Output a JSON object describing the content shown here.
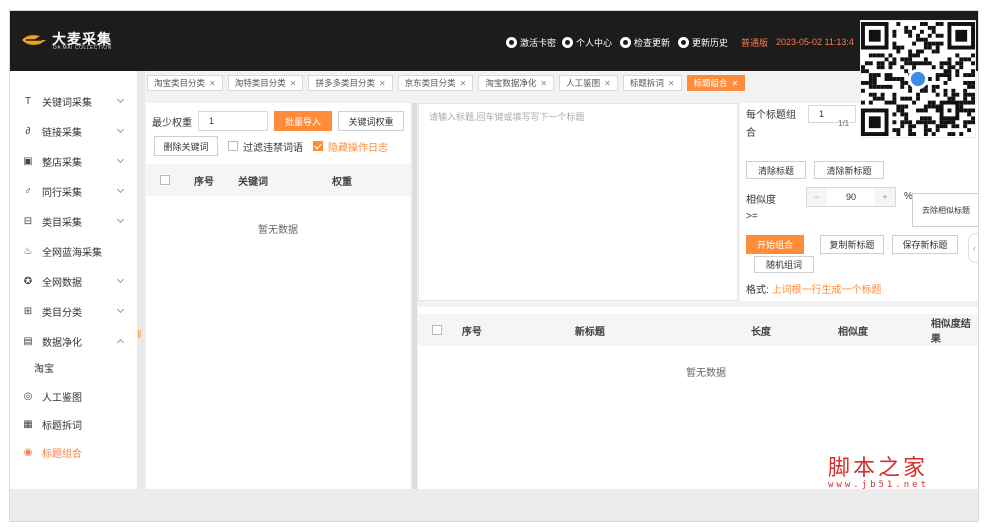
{
  "header": {
    "brand": "大麦采集",
    "brand_sub": "DA MAI COLLECTION",
    "menu": [
      {
        "label": "激活卡密",
        "icon": "key-icon"
      },
      {
        "label": "个人中心",
        "icon": "user-icon"
      },
      {
        "label": "检查更新",
        "icon": "refresh-icon"
      },
      {
        "label": "更新历史",
        "icon": "history-icon"
      }
    ],
    "edition": "普通版",
    "datetime": "2023-05-02 11:13:4"
  },
  "sidebar": {
    "items": [
      {
        "label": "关键词采集",
        "icon": "text-icon",
        "chevron": "down"
      },
      {
        "label": "链接采集",
        "icon": "link-icon",
        "chevron": "down"
      },
      {
        "label": "整店采集",
        "icon": "store-icon",
        "chevron": "down"
      },
      {
        "label": "同行采集",
        "icon": "users-icon",
        "chevron": "down"
      },
      {
        "label": "类目采集",
        "icon": "category-icon",
        "chevron": "down"
      },
      {
        "label": "全网蓝海采集",
        "icon": "fire-icon",
        "chevron": "none"
      },
      {
        "label": "全网数据",
        "icon": "globe-icon",
        "chevron": "down"
      },
      {
        "label": "类目分类",
        "icon": "grid-icon",
        "chevron": "down"
      },
      {
        "label": "数据净化",
        "icon": "filter-icon",
        "chevron": "up"
      }
    ],
    "sub_label": "淘宝",
    "sub_items": [
      {
        "label": "人工鉴图",
        "icon": "image-check-icon"
      },
      {
        "label": "标题拆词",
        "icon": "split-icon"
      },
      {
        "label": "标题组合",
        "icon": "combine-icon",
        "active": true
      }
    ]
  },
  "tabs": [
    {
      "label": "淘宝类目分类",
      "active": false
    },
    {
      "label": "淘特类目分类",
      "active": false
    },
    {
      "label": "拼多多类目分类",
      "active": false
    },
    {
      "label": "京东类目分类",
      "active": false
    },
    {
      "label": "淘宝数据净化",
      "active": false
    },
    {
      "label": "人工鉴图",
      "active": false
    },
    {
      "label": "标题拆词",
      "active": false
    },
    {
      "label": "标题组合",
      "active": true
    }
  ],
  "left_panel": {
    "min_weight_label": "最少权重",
    "min_weight_value": "1",
    "import_button": "批量导入",
    "keyword_weight_button": "关键词权重",
    "delete_keyword_button": "删除关键词",
    "filter_banned_label": "过滤违禁词语",
    "hide_log_label": "隐藏操作日志",
    "columns": [
      "序号",
      "关键词",
      "权重"
    ],
    "empty_text": "暂无数据"
  },
  "middle": {
    "placeholder": "请输入标题,回车键或填写写下一个标题"
  },
  "right_panel": {
    "per_title_label": "每个标题组合",
    "per_title_value": "1",
    "page_indicator": "1/1",
    "clear_titles_button": "清除标题",
    "clear_new_titles_button": "清除新标题",
    "similarity_label": "相似度",
    "similarity_ge": ">=",
    "similarity_value": "90",
    "similarity_unit": "%",
    "dedupe_button": "去除相似标题",
    "start_button": "开始组合",
    "copy_button": "复制新标题",
    "save_button": "保存新标题",
    "random_button": "随机组词",
    "format_label": "格式:",
    "format_text": "上词根一行生成一个标题"
  },
  "result_table": {
    "columns": [
      "序号",
      "新标题",
      "长度",
      "相似度",
      "相似度结果"
    ],
    "empty_text": "暂无数据"
  },
  "watermark": {
    "main": "脚本之家",
    "sub": "www.jb51.net"
  }
}
